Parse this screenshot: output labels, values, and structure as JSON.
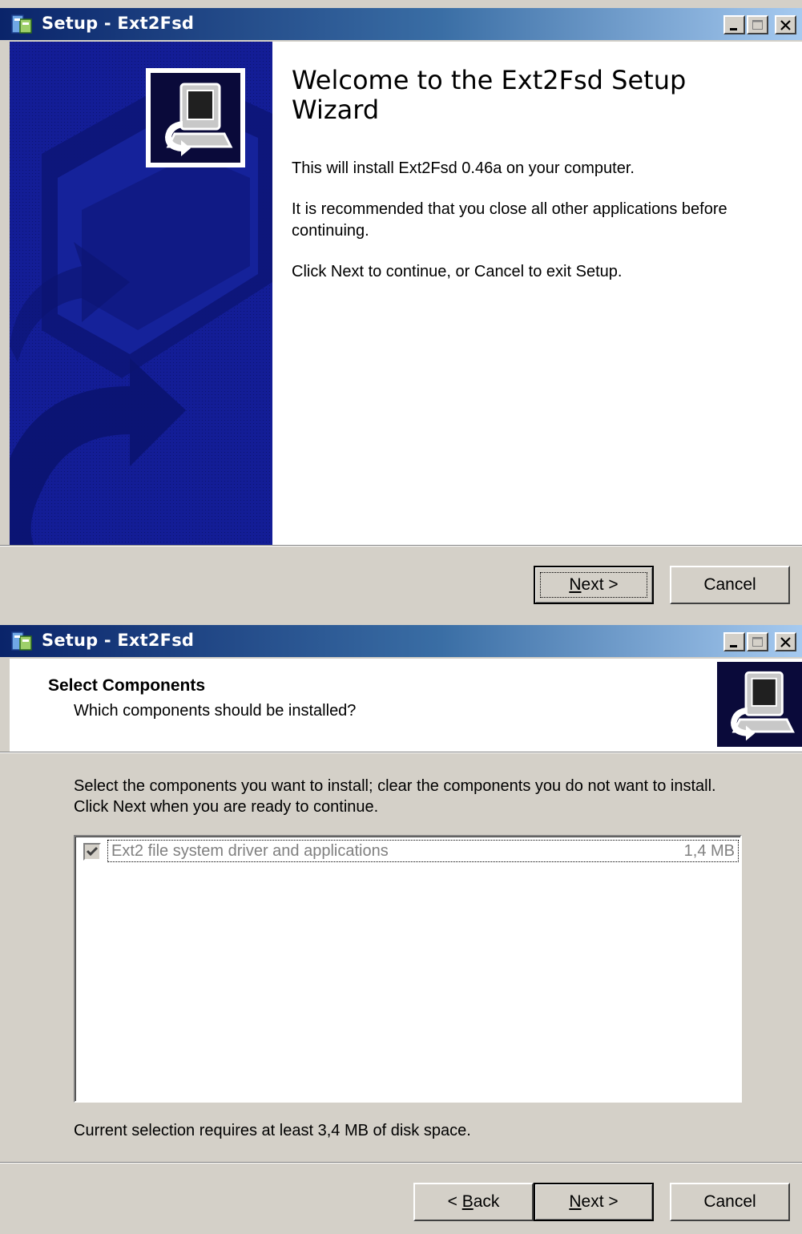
{
  "window1": {
    "title": "Setup - Ext2Fsd",
    "welcome_title": "Welcome to the Ext2Fsd Setup Wizard",
    "para1": "This will install Ext2Fsd 0.46a on your computer.",
    "para2": "It is recommended that you close all other applications before continuing.",
    "para3": "Click Next to continue, or Cancel to exit Setup.",
    "next_label_accel": "N",
    "next_label_rest": "ext >",
    "cancel_label": "Cancel"
  },
  "window2": {
    "title": "Setup - Ext2Fsd",
    "header_title": "Select Components",
    "header_subtitle": "Which components should be installed?",
    "instructions": "Select the components you want to install; clear the components you do not want to install. Click Next when you are ready to continue.",
    "components": [
      {
        "name": "Ext2 file system driver and applications",
        "size": "1,4 MB",
        "checked": true,
        "disabled": true
      }
    ],
    "disk_space": "Current selection requires at least 3,4 MB of disk space.",
    "back_label_prefix": "< ",
    "back_label_accel": "B",
    "back_label_rest": "ack",
    "next_label_accel": "N",
    "next_label_rest": "ext >",
    "cancel_label": "Cancel"
  },
  "icons": {
    "app": "setup-app-icon",
    "minimize": "minimize-icon",
    "maximize": "maximize-icon",
    "close": "close-icon",
    "wizard_logo": "computer-install-icon"
  },
  "colors": {
    "titlebar_start": "#0a246a",
    "titlebar_end": "#a6caf0",
    "sidebar": "#101a8c",
    "face": "#d4d0c8"
  }
}
